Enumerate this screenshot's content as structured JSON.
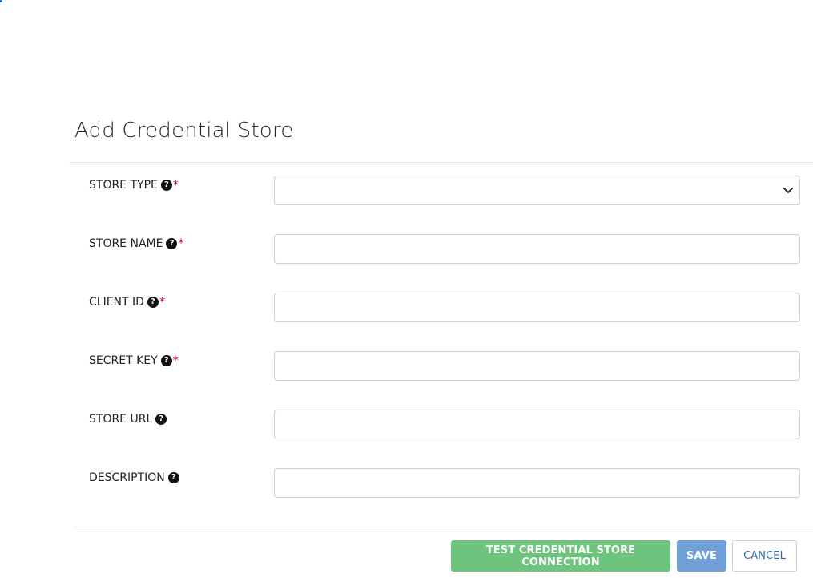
{
  "page": {
    "title": "Add Credential Store"
  },
  "form": {
    "fields": [
      {
        "label": "STORE TYPE",
        "required": true,
        "help_icon": "question-circle-icon",
        "kind": "select",
        "value": ""
      },
      {
        "label": "STORE NAME",
        "required": true,
        "help_icon": "question-circle-icon",
        "kind": "text",
        "value": ""
      },
      {
        "label": "CLIENT ID",
        "required": true,
        "help_icon": "question-circle-icon",
        "kind": "text",
        "value": ""
      },
      {
        "label": "SECRET KEY",
        "required": true,
        "help_icon": "question-circle-icon",
        "kind": "text",
        "value": ""
      },
      {
        "label": "STORE URL",
        "required": false,
        "help_icon": "question-circle-icon",
        "kind": "text",
        "value": ""
      },
      {
        "label": "DESCRIPTION",
        "required": false,
        "help_icon": "question-circle-icon",
        "kind": "text",
        "value": ""
      }
    ],
    "required_marker": "*",
    "help_glyph": "?"
  },
  "actions": {
    "test_label": "TEST CREDENTIAL STORE CONNECTION",
    "save_label": "SAVE",
    "cancel_label": "CANCEL"
  },
  "colors": {
    "test_button": "#6dc47c",
    "save_button": "#6f9fd6",
    "cancel_text": "#2b6aa8",
    "required": "#d0021b"
  }
}
